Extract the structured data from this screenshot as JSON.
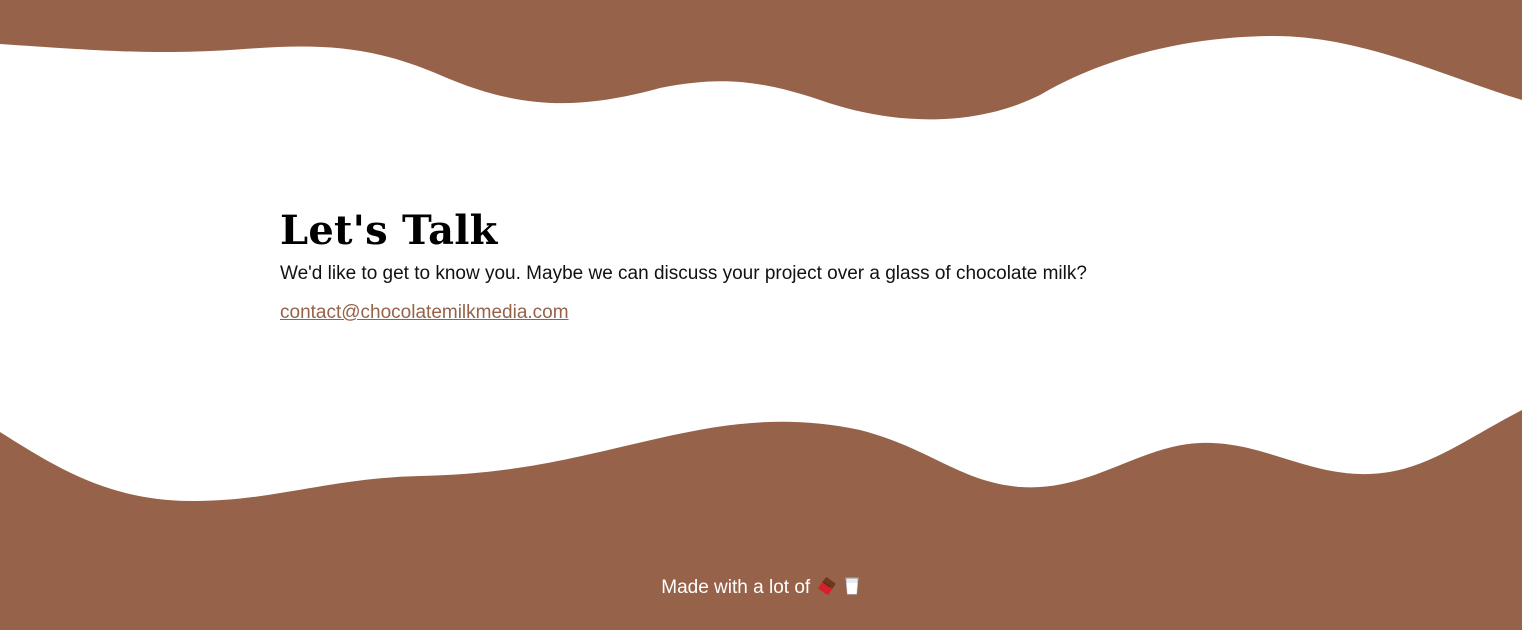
{
  "colors": {
    "brand_brown": "#96624a",
    "background": "#ffffff",
    "text": "#000000"
  },
  "contact": {
    "title": "Let's Talk",
    "description": "We'd like to get to know you. Maybe we can discuss your project over a glass of chocolate milk?",
    "email": "contact@chocolatemilkmedia.com"
  },
  "footer": {
    "text": "Made with a lot of",
    "icons": [
      "chocolate-bar-icon",
      "milk-glass-icon"
    ]
  }
}
